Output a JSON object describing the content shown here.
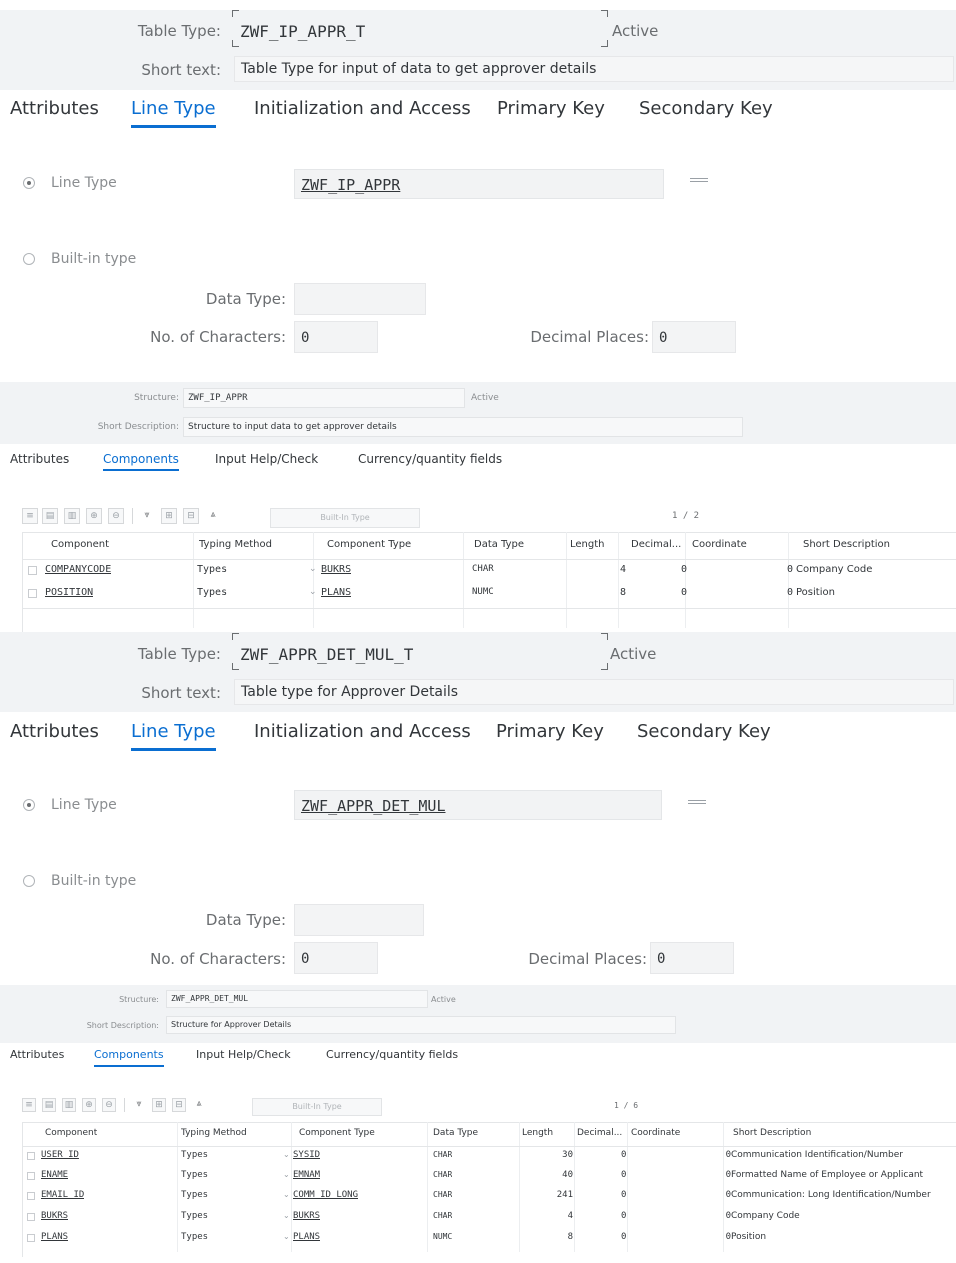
{
  "block1": {
    "table_type_label": "Table Type:",
    "table_type_value": "ZWF_IP_APPR_T",
    "status": "Active",
    "short_text_label": "Short text:",
    "short_text_value": "Table Type for input of data to get approver details",
    "tabs": [
      "Attributes",
      "Line Type",
      "Initialization and Access",
      "Primary Key",
      "Secondary Key"
    ],
    "selected_tab": "Line Type",
    "line_type_label": "Line Type",
    "line_type_value": "ZWF_IP_APPR",
    "builtin_label": "Built-in type",
    "data_type_label": "Data Type:",
    "data_type_value": "",
    "no_chars_label": "No. of Characters:",
    "no_chars_value": "0",
    "decimals_label": "Decimal Places:",
    "decimals_value": "0"
  },
  "struct1": {
    "structure_label": "Structure:",
    "structure_value": "ZWF_IP_APPR",
    "status": "Active",
    "short_desc_label": "Short Description:",
    "short_desc_value": "Structure to input data to get approver details",
    "tabs": [
      "Attributes",
      "Components",
      "Input Help/Check",
      "Currency/quantity fields"
    ],
    "selected_tab": "Components",
    "builtin_button": "Built-In Type",
    "pager": "1 / 2",
    "columns": [
      "Component",
      "Typing Method",
      "Component Type",
      "Data Type",
      "Length",
      "Decimal...",
      "Coordinate",
      "Short Description"
    ],
    "rows": [
      {
        "component": "COMPANYCODE",
        "typing": "Types",
        "ctype": "BUKRS",
        "dtype": "CHAR",
        "length": "4",
        "decimals": "0",
        "coord": "0",
        "desc": "Company Code"
      },
      {
        "component": "POSITION",
        "typing": "Types",
        "ctype": "PLANS",
        "dtype": "NUMC",
        "length": "8",
        "decimals": "0",
        "coord": "0",
        "desc": "Position"
      }
    ]
  },
  "block2": {
    "table_type_label": "Table Type:",
    "table_type_value": "ZWF_APPR_DET_MUL_T",
    "status": "Active",
    "short_text_label": "Short text:",
    "short_text_value": "Table type for Approver Details",
    "tabs": [
      "Attributes",
      "Line Type",
      "Initialization and Access",
      "Primary Key",
      "Secondary Key"
    ],
    "selected_tab": "Line Type",
    "line_type_label": "Line Type",
    "line_type_value": "ZWF_APPR_DET_MUL",
    "builtin_label": "Built-in type",
    "data_type_label": "Data Type:",
    "data_type_value": "",
    "no_chars_label": "No. of Characters:",
    "no_chars_value": "0",
    "decimals_label": "Decimal Places:",
    "decimals_value": "0"
  },
  "struct2": {
    "structure_label": "Structure:",
    "structure_value": "ZWF_APPR_DET_MUL",
    "status": "Active",
    "short_desc_label": "Short Description:",
    "short_desc_value": "Structure for Approver Details",
    "tabs": [
      "Attributes",
      "Components",
      "Input Help/Check",
      "Currency/quantity fields"
    ],
    "selected_tab": "Components",
    "builtin_button": "Built-In Type",
    "pager": "1 / 6",
    "columns": [
      "Component",
      "Typing Method",
      "Component Type",
      "Data Type",
      "Length",
      "Decimal...",
      "Coordinate",
      "Short Description"
    ],
    "rows": [
      {
        "component": "USER_ID",
        "typing": "Types",
        "ctype": "SYSID",
        "dtype": "CHAR",
        "length": "30",
        "decimals": "0",
        "coord": "0",
        "desc": "Communication Identification/Number"
      },
      {
        "component": "ENAME",
        "typing": "Types",
        "ctype": "EMNAM",
        "dtype": "CHAR",
        "length": "40",
        "decimals": "0",
        "coord": "0",
        "desc": "Formatted Name of Employee or Applicant"
      },
      {
        "component": "EMAIL_ID",
        "typing": "Types",
        "ctype": "COMM_ID_LONG",
        "dtype": "CHAR",
        "length": "241",
        "decimals": "0",
        "coord": "0",
        "desc": "Communication: Long Identification/Number"
      },
      {
        "component": "BUKRS",
        "typing": "Types",
        "ctype": "BUKRS",
        "dtype": "CHAR",
        "length": "4",
        "decimals": "0",
        "coord": "0",
        "desc": "Company Code"
      },
      {
        "component": "PLANS",
        "typing": "Types",
        "ctype": "PLANS",
        "dtype": "NUMC",
        "length": "8",
        "decimals": "0",
        "coord": "0",
        "desc": "Position"
      }
    ]
  }
}
